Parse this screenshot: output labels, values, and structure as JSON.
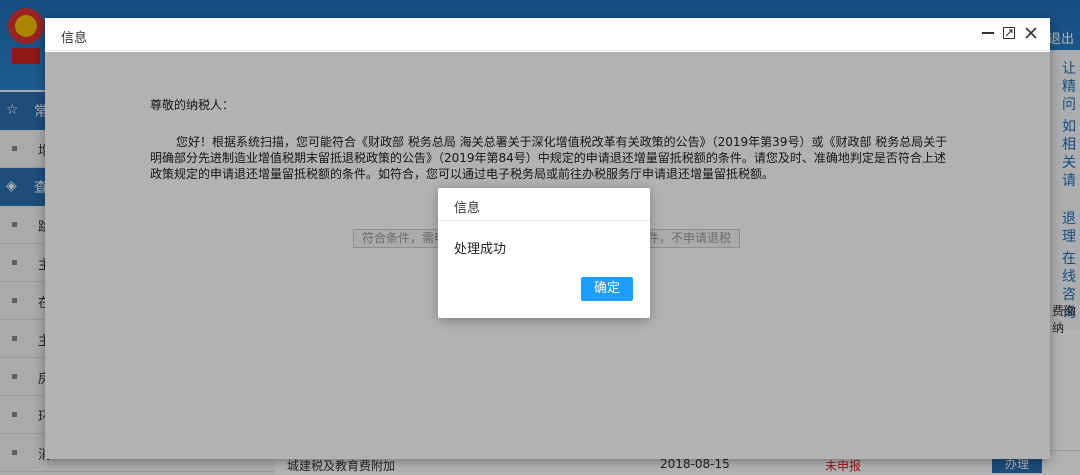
{
  "window": {
    "title": "信息",
    "controls": [
      "minimize-icon",
      "maximize-icon",
      "close-icon"
    ]
  },
  "content": {
    "greeting": "尊敬的纳税人：",
    "paragraph": "您好！根据系统扫描，您可能符合《财政部 税务总局 海关总署关于深化增值税改革有关政策的公告》（2019年第39号）或《财政部 税务总局关于明确部分先进制造业增值税期末留抵退税政策的公告》（2019年第84号）中规定的申请退还增量留抵税额的条件。请您及时、准确地判定是否符合上述政策规定的申请退还增量留抵税额的条件。如符合，您可以通过电子税务局或前往办税服务厅申请退还增量留抵税额。",
    "button_left": "符合条件，需申",
    "button_right": "件，不申请退税"
  },
  "dialog": {
    "title": "信息",
    "message": "处理成功",
    "ok_label": "确定"
  },
  "background": {
    "logout_label": "退出",
    "sidebar_head_1": "常",
    "sidebar_head_2": "查",
    "sidebar_rows": [
      "增",
      "跳",
      "主",
      "在",
      "主",
      "房",
      "环",
      "消"
    ],
    "right_panel_cols": [
      "让精问",
      "如相关请",
      "退理",
      "在线咨询"
    ],
    "right_label": "费缴纳",
    "table_row": {
      "name": "城建税及教育费附加",
      "date": "2018-08-15",
      "status": "未申报",
      "action": "办理"
    }
  },
  "colors": {
    "primary_button": "#1e9fff",
    "header_blue": "#2a6fb0"
  }
}
